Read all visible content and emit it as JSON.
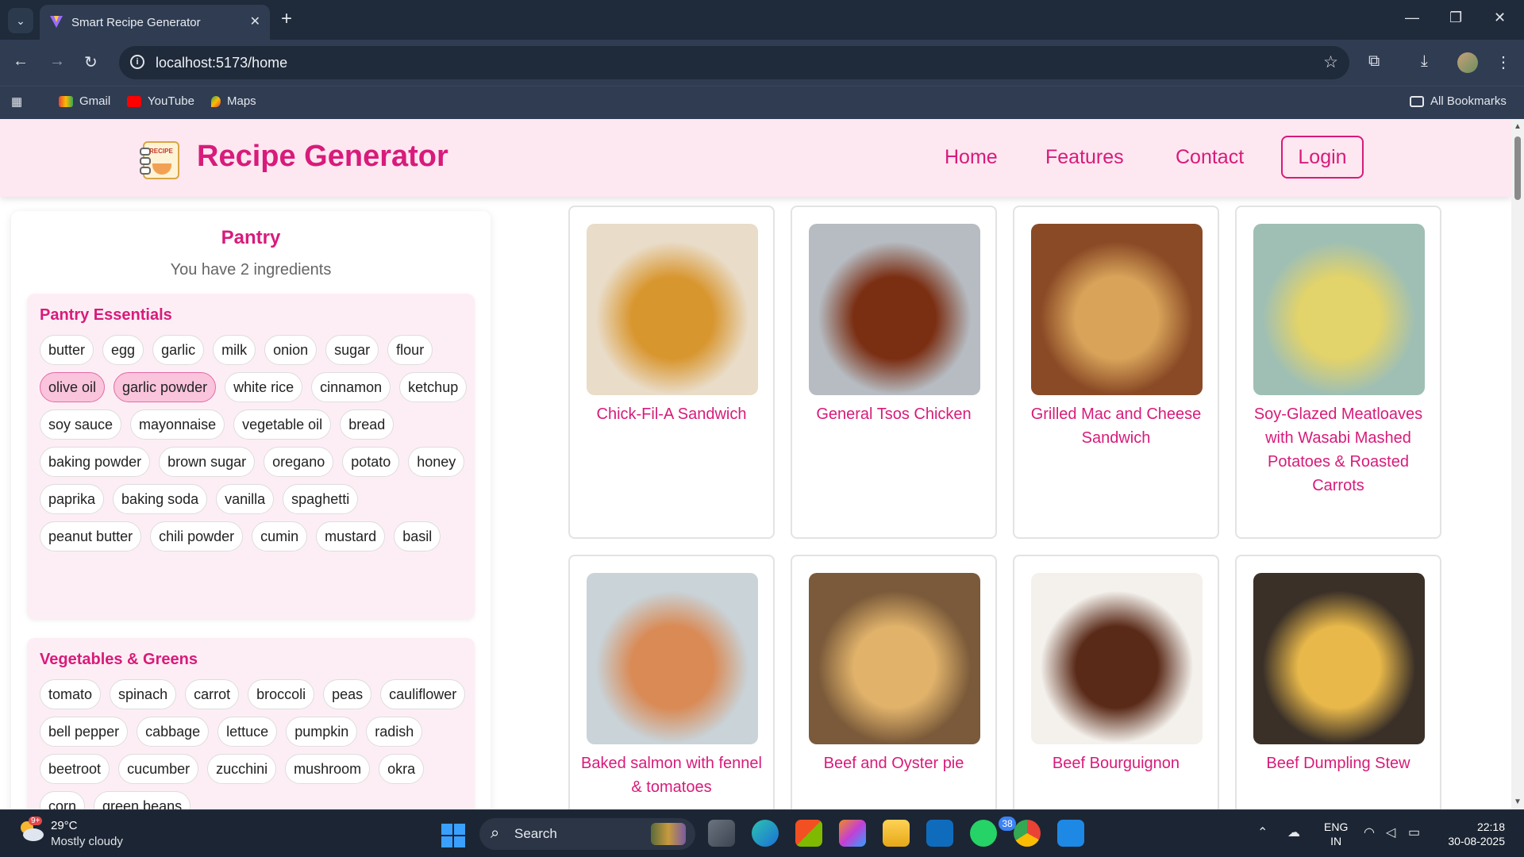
{
  "browser": {
    "tab_title": "Smart Recipe Generator",
    "url": "localhost:5173/home",
    "bookmarks": [
      "Gmail",
      "YouTube",
      "Maps"
    ],
    "all_bookmarks": "All Bookmarks"
  },
  "header": {
    "brand": "Recipe Generator",
    "logo_text": "RECIPE",
    "nav": [
      "Home",
      "Features",
      "Contact"
    ],
    "login": "Login",
    "accent_color": "#d81b7a",
    "background_color": "#fde7f1"
  },
  "pantry": {
    "title": "Pantry",
    "subtitle": "You have 2 ingredients",
    "categories": [
      {
        "title": "Pantry Essentials",
        "items": [
          {
            "label": "butter",
            "selected": false
          },
          {
            "label": "egg",
            "selected": false
          },
          {
            "label": "garlic",
            "selected": false
          },
          {
            "label": "milk",
            "selected": false
          },
          {
            "label": "onion",
            "selected": false
          },
          {
            "label": "sugar",
            "selected": false
          },
          {
            "label": "flour",
            "selected": false
          },
          {
            "label": "olive oil",
            "selected": true
          },
          {
            "label": "garlic powder",
            "selected": true
          },
          {
            "label": "white rice",
            "selected": false
          },
          {
            "label": "cinnamon",
            "selected": false
          },
          {
            "label": "ketchup",
            "selected": false
          },
          {
            "label": "soy sauce",
            "selected": false
          },
          {
            "label": "mayonnaise",
            "selected": false
          },
          {
            "label": "vegetable oil",
            "selected": false
          },
          {
            "label": "bread",
            "selected": false
          },
          {
            "label": "baking powder",
            "selected": false
          },
          {
            "label": "brown sugar",
            "selected": false
          },
          {
            "label": "oregano",
            "selected": false
          },
          {
            "label": "potato",
            "selected": false
          },
          {
            "label": "honey",
            "selected": false
          },
          {
            "label": "paprika",
            "selected": false
          },
          {
            "label": "baking soda",
            "selected": false
          },
          {
            "label": "vanilla",
            "selected": false
          },
          {
            "label": "spaghetti",
            "selected": false
          },
          {
            "label": "peanut butter",
            "selected": false
          },
          {
            "label": "chili powder",
            "selected": false
          },
          {
            "label": "cumin",
            "selected": false
          },
          {
            "label": "mustard",
            "selected": false
          },
          {
            "label": "basil",
            "selected": false
          }
        ]
      },
      {
        "title": "Vegetables & Greens",
        "items": [
          {
            "label": "tomato",
            "selected": false
          },
          {
            "label": "spinach",
            "selected": false
          },
          {
            "label": "carrot",
            "selected": false
          },
          {
            "label": "broccoli",
            "selected": false
          },
          {
            "label": "peas",
            "selected": false
          },
          {
            "label": "cauliflower",
            "selected": false
          },
          {
            "label": "bell pepper",
            "selected": false
          },
          {
            "label": "cabbage",
            "selected": false
          },
          {
            "label": "lettuce",
            "selected": false
          },
          {
            "label": "pumpkin",
            "selected": false
          },
          {
            "label": "radish",
            "selected": false
          },
          {
            "label": "beetroot",
            "selected": false
          },
          {
            "label": "cucumber",
            "selected": false
          },
          {
            "label": "zucchini",
            "selected": false
          },
          {
            "label": "mushroom",
            "selected": false
          },
          {
            "label": "okra",
            "selected": false
          },
          {
            "label": "corn",
            "selected": false
          },
          {
            "label": "green beans",
            "selected": false
          }
        ]
      }
    ]
  },
  "recipes": [
    {
      "name": "Chick-Fil-A Sandwich",
      "image": "burger",
      "colors": [
        "#e9dcc8",
        "#d8962f"
      ]
    },
    {
      "name": "General Tsos Chicken",
      "image": "chicken-bowl",
      "colors": [
        "#b6bcc2",
        "#7a2e12"
      ]
    },
    {
      "name": "Grilled Mac and Cheese Sandwich",
      "image": "grilled-sandwich",
      "colors": [
        "#8a4a26",
        "#d9a45a"
      ]
    },
    {
      "name": "Soy-Glazed Meatloaves with Wasabi Mashed Potatoes & Roasted Carrots",
      "image": "meatloaf-plate",
      "colors": [
        "#9fbfb4",
        "#e2d36a"
      ]
    },
    {
      "name": "Baked salmon with fennel & tomatoes",
      "image": "salmon",
      "colors": [
        "#c9d3d8",
        "#d98a55"
      ]
    },
    {
      "name": "Beef and Oyster pie",
      "image": "pie",
      "colors": [
        "#7a5a3a",
        "#e0b26a"
      ]
    },
    {
      "name": "Beef Bourguignon",
      "image": "stew-pot",
      "colors": [
        "#f4f1ec",
        "#5a2a18"
      ]
    },
    {
      "name": "Beef Dumpling Stew",
      "image": "dumpling-pan",
      "colors": [
        "#3a3028",
        "#e8b84a"
      ]
    }
  ],
  "taskbar": {
    "weather_temp": "29°C",
    "weather_desc": "Mostly cloudy",
    "weather_badge": "9+",
    "search_label": "Search",
    "whatsapp_badge": "38",
    "lang_top": "ENG",
    "lang_bottom": "IN",
    "time": "22:18",
    "date": "30-08-2025"
  }
}
